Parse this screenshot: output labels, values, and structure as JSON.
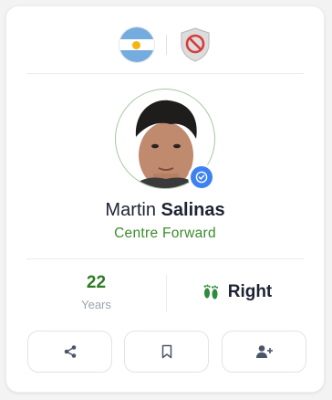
{
  "header": {
    "flag_icon": "argentina-flag-icon",
    "status_icon": "ban-shield-icon",
    "status_color": "#d83b3b"
  },
  "player": {
    "first_name": "Martin",
    "last_name": "Salinas",
    "position": "Centre Forward",
    "verified_icon": "verified-check-icon",
    "verified_color": "#3d82f0"
  },
  "stats": {
    "age_value": "22",
    "age_label": "Years",
    "foot_icon": "footprints-icon",
    "foot_value": "Right"
  },
  "actions": [
    {
      "icon": "share-icon"
    },
    {
      "icon": "bookmark-icon"
    },
    {
      "icon": "user-plus-icon"
    }
  ],
  "colors": {
    "accent_green": "#3b8c2a",
    "text_dark": "#1d2433",
    "muted": "#9aa3b0"
  }
}
